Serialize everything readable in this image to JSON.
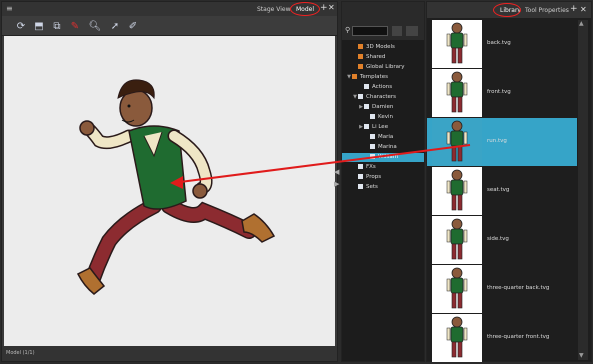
{
  "left_panel": {
    "tabs": [
      "Stage View",
      "Model"
    ],
    "active_tab": "Model",
    "status": "Model  (1/1)"
  },
  "toolbar": {
    "tools": [
      "import-icon",
      "export-icon",
      "copy-icon",
      "pen-icon",
      "zoom-icon",
      "select-icon",
      "brush-icon"
    ]
  },
  "tree": {
    "items": [
      {
        "label": "3D Models",
        "indent": 1,
        "arrow": "",
        "icon": "folder"
      },
      {
        "label": "Shared",
        "indent": 1,
        "arrow": "",
        "icon": "folder"
      },
      {
        "label": "Global Library",
        "indent": 1,
        "arrow": "",
        "icon": "folder"
      },
      {
        "label": "Templates",
        "indent": 0,
        "arrow": "▼",
        "icon": "folder"
      },
      {
        "label": "Actions",
        "indent": 2,
        "arrow": "",
        "icon": "doc"
      },
      {
        "label": "Characters",
        "indent": 1,
        "arrow": "▼",
        "icon": "doc"
      },
      {
        "label": "Damien",
        "indent": 2,
        "arrow": "▶",
        "icon": "doc"
      },
      {
        "label": "Kevin",
        "indent": 3,
        "arrow": "",
        "icon": "doc"
      },
      {
        "label": "Li Lee",
        "indent": 2,
        "arrow": "▶",
        "icon": "doc"
      },
      {
        "label": "Maria",
        "indent": 3,
        "arrow": "",
        "icon": "doc"
      },
      {
        "label": "Marina",
        "indent": 3,
        "arrow": "",
        "icon": "doc"
      },
      {
        "label": "William",
        "indent": 3,
        "arrow": "",
        "icon": "doc",
        "selected": true
      },
      {
        "label": "FXs",
        "indent": 1,
        "arrow": "",
        "icon": "doc"
      },
      {
        "label": "Props",
        "indent": 1,
        "arrow": "",
        "icon": "doc"
      },
      {
        "label": "Sets",
        "indent": 1,
        "arrow": "",
        "icon": "doc"
      }
    ]
  },
  "library": {
    "tabs": [
      "Library",
      "Tool Properties"
    ],
    "active_tab": "Library",
    "items": [
      {
        "label": "back.tvg"
      },
      {
        "label": "front.tvg"
      },
      {
        "label": "run.tvg",
        "selected": true
      },
      {
        "label": "seat.tvg"
      },
      {
        "label": "side.tvg"
      },
      {
        "label": "three-quarter back.tvg"
      },
      {
        "label": "three-quarter front.tvg"
      }
    ]
  },
  "colors": {
    "selection": "#36a4c8",
    "annotation": "#e01b1b",
    "shirt": "#1f6b30",
    "pants": "#8c2b30",
    "skin": "#8a5a3c",
    "sleeve": "#efe6c6"
  }
}
